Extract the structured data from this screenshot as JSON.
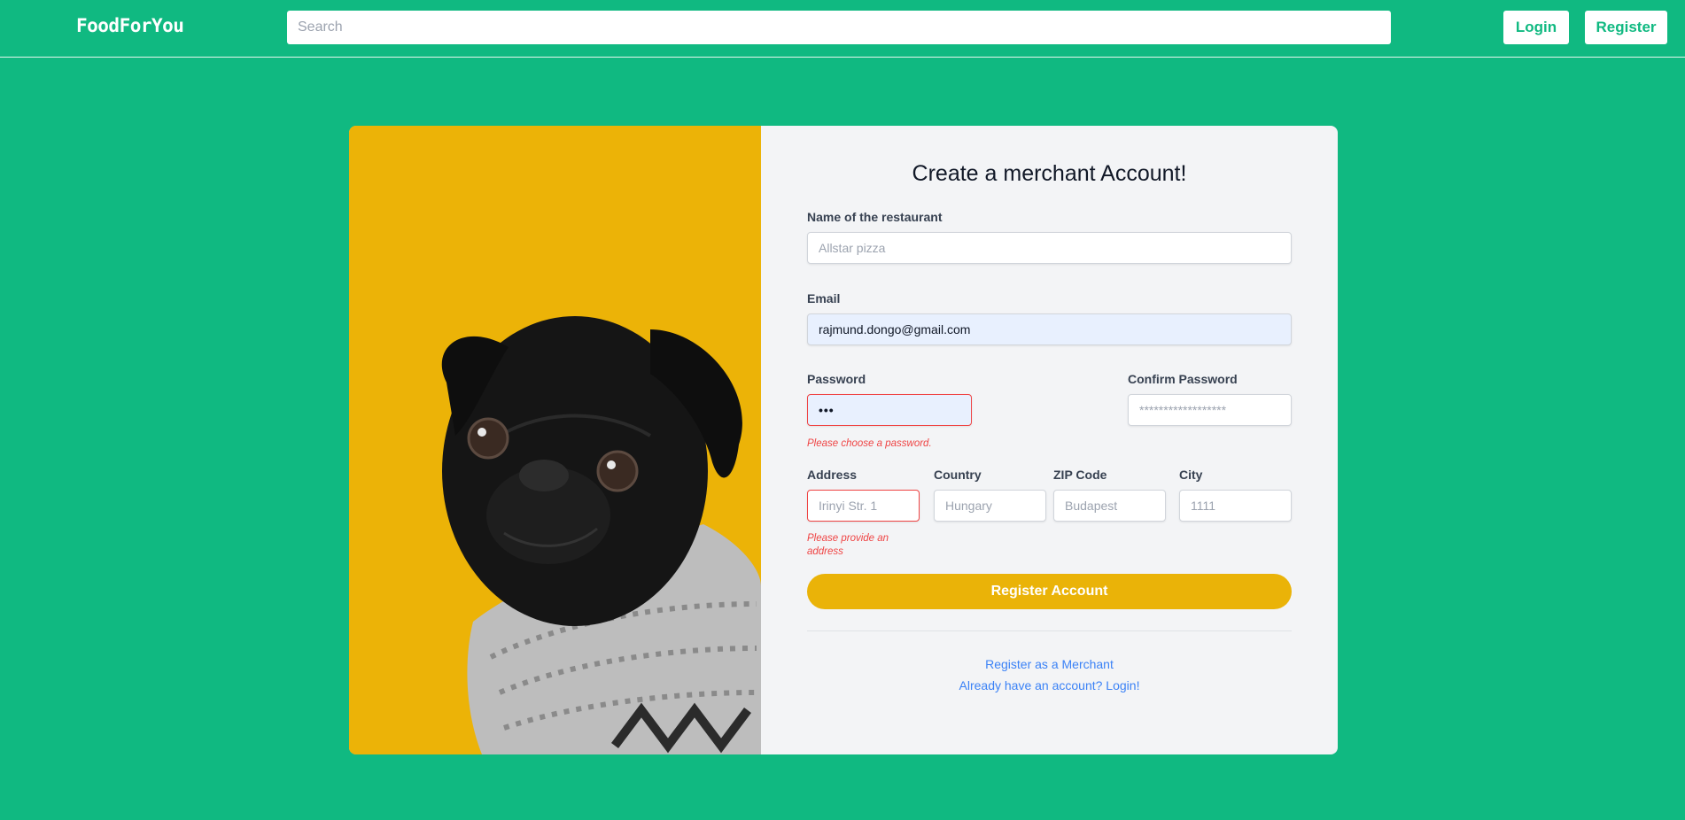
{
  "navbar": {
    "brand": "FoodForYou",
    "search_placeholder": "Search",
    "login_label": "Login",
    "register_label": "Register"
  },
  "form": {
    "title": "Create a merchant Account!",
    "restaurant": {
      "label": "Name of the restaurant",
      "placeholder": "Allstar pizza",
      "value": ""
    },
    "email": {
      "label": "Email",
      "value": "rajmund.dongo@gmail.com"
    },
    "password": {
      "label": "Password",
      "value": "•••",
      "error": "Please choose a password."
    },
    "confirm_password": {
      "label": "Confirm Password",
      "placeholder": "******************",
      "value": ""
    },
    "address": {
      "label": "Address",
      "placeholder": "Irinyi Str. 1",
      "value": "",
      "error": "Please provide an address"
    },
    "country": {
      "label": "Country",
      "placeholder": "Hungary",
      "value": ""
    },
    "zip": {
      "label": "ZIP Code",
      "placeholder": "Budapest",
      "value": ""
    },
    "city": {
      "label": "City",
      "placeholder": "1111",
      "value": ""
    },
    "submit_label": "Register Account",
    "merchant_link": "Register as a Merchant",
    "login_link": "Already have an account? Login!"
  },
  "colors": {
    "page_background": "#10b981",
    "photo_background": "#ecb307",
    "button_yellow": "#eab308",
    "error_red": "#ef4444",
    "link_blue": "#3b82f6"
  }
}
